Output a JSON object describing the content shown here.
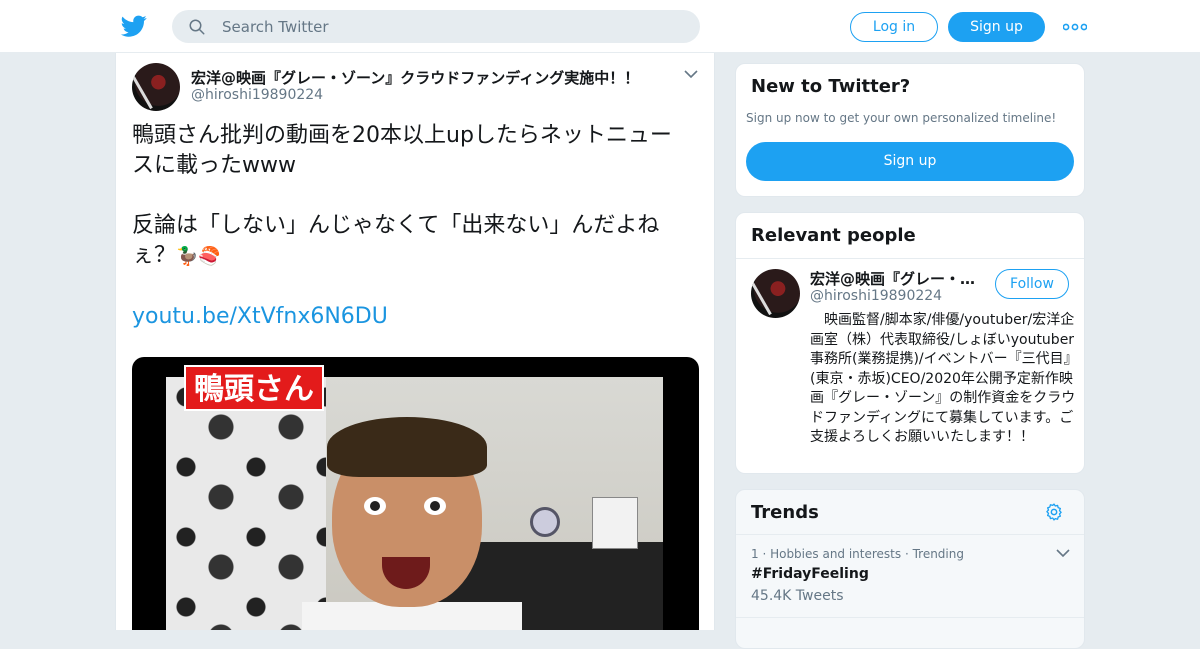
{
  "header": {
    "search_placeholder": "Search Twitter",
    "login_label": "Log in",
    "signup_label": "Sign up",
    "accent": "#1da1f2"
  },
  "tweet": {
    "author_name": "宏洋@映画『グレー・ゾーン』クラウドファンディング実施中！！",
    "author_handle": "@hiroshi19890224",
    "line1": "鴨頭さん批判の動画を20本以上upしたらネットニュースに載ったwww",
    "line2_text": "反論は「しない」んじゃなくて「出来ない」んだよねぇ？",
    "line2_emoji": "🦆🍣",
    "link": "youtu.be/XtVfnx6N6DU",
    "media_caption": "鴨頭さん"
  },
  "new_to_twitter": {
    "title": "New to Twitter?",
    "subtitle": "Sign up now to get your own personalized timeline!",
    "button_label": "Sign up"
  },
  "relevant_people": {
    "title": "Relevant people",
    "name": "宏洋@映画『グレー・ゾーン』クラウドファンディング実施中！！",
    "handle": "@hiroshi19890224",
    "follow_label": "Follow",
    "bio": "　映画監督/脚本家/俳優/youtuber/宏洋企画室（株）代表取締役/しょぼいyoutuber事務所(業務提携)/イベントバー『三代目』(東京・赤坂)CEO/2020年公開予定新作映画『グレー・ゾーン』の制作資金をクラウドファンディングにて募集しています。ご支援よろしくお願いいたします！！"
  },
  "trends": {
    "title": "Trends",
    "items": [
      {
        "meta": "1 · Hobbies and interests · Trending",
        "name": "#FridayFeeling",
        "count": "45.4K Tweets"
      }
    ]
  }
}
